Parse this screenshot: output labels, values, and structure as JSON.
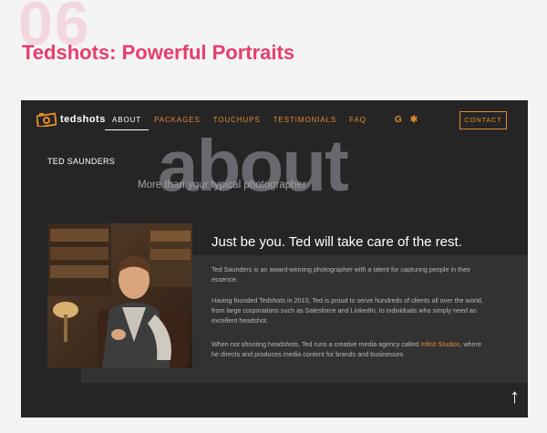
{
  "case_study": {
    "number": "06",
    "title": "Tedshots: Powerful Portraits"
  },
  "site": {
    "logo_text": "tedshots",
    "nav": [
      "ABOUT",
      "PACKAGES",
      "TOUCHUPS",
      "TESTIMONIALS",
      "FAQ"
    ],
    "active_nav": "ABOUT",
    "social": [
      "G",
      "✱"
    ],
    "contact_label": "CONTACT"
  },
  "hero": {
    "owner_name": "TED SAUNDERS",
    "big_word": "about",
    "subtitle": "More than your typical photographer"
  },
  "content": {
    "tagline": "Just be you. Ted will take care of the rest.",
    "p1": "Ted Saunders is an award-winning photographer with a talent for capturing people in their essence.",
    "p2": "Having founded Tedshots in 2010, Ted is proud to serve hundreds of clients all over the world, from large corporations such as Salesforce and LinkedIn, to individuals who simply need an excellent headshot.",
    "p3_before": "When not shooting headshots, Ted runs a creative media agency called ",
    "p3_link": "Infinit Studios",
    "p3_after": ", where he directs and produces media content for brands and businesses."
  },
  "scroll_top": "↑",
  "colors": {
    "accent": "#e28a2b",
    "title_pink": "#e63e6d",
    "frame_bg": "#262526"
  }
}
